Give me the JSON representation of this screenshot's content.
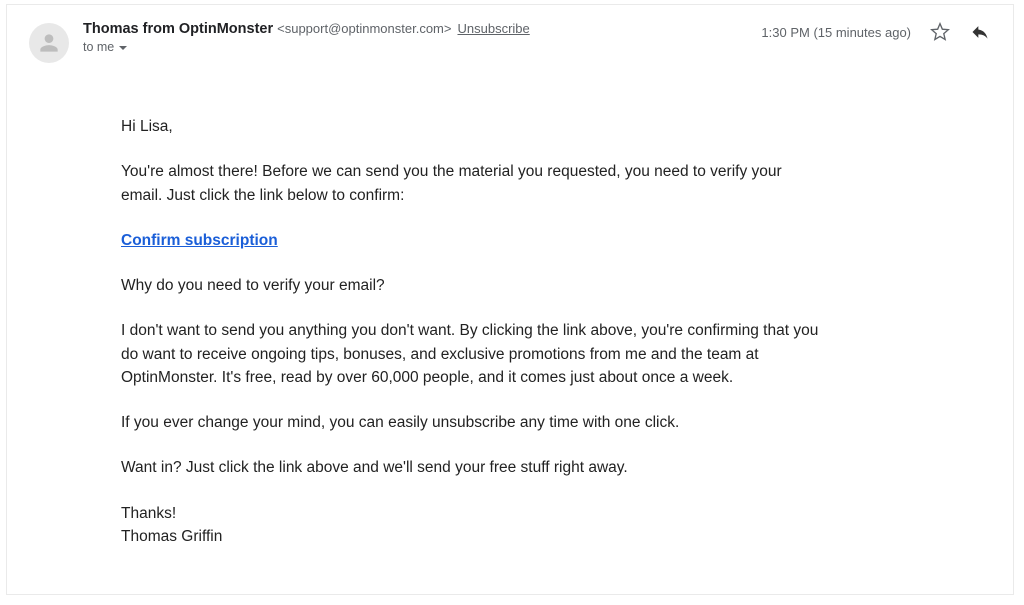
{
  "header": {
    "sender_name": "Thomas from OptinMonster",
    "sender_email": "<support@optinmonster.com>",
    "unsubscribe_label": "Unsubscribe",
    "to_label": "to me",
    "timestamp": "1:30 PM (15 minutes ago)"
  },
  "body": {
    "greeting": "Hi Lisa,",
    "intro": "You're almost there! Before we can send you the material you requested, you need to verify your email. Just click the link below to confirm:",
    "confirm_link_label": "Confirm subscription",
    "why_q": "Why do you need to verify your email?",
    "explain": "I don't want to send you anything you don't want. By clicking the link above, you're confirming that you do want to receive ongoing tips, bonuses, and exclusive promotions from me and the team at OptinMonster. It's free, read by over 60,000 people, and it comes just about once a week.",
    "unsub_note": "If you ever change your mind, you can easily unsubscribe any time with one click.",
    "cta": "Want in? Just click the link above and we'll send your free stuff right away.",
    "thanks": "Thanks!",
    "signature": "Thomas Griffin"
  }
}
